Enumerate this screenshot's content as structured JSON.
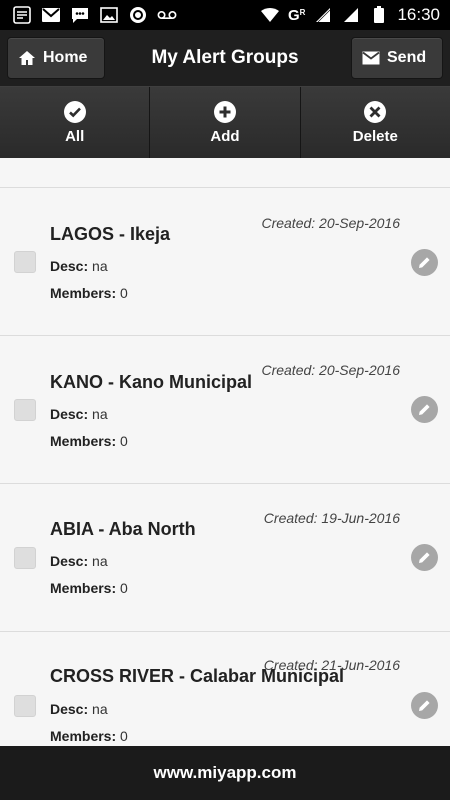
{
  "status_bar": {
    "time": "16:30",
    "network_label": "G",
    "network_sub": "R",
    "icons": [
      "notification-icon",
      "gmail-icon",
      "chat-icon",
      "image-icon",
      "app-icon",
      "voicemail-icon",
      "wifi-icon",
      "signal-icon",
      "signal-icon",
      "battery-icon"
    ]
  },
  "header": {
    "home_label": "Home",
    "title": "My Alert Groups",
    "send_label": "Send"
  },
  "toolbar": {
    "all_label": "All",
    "add_label": "Add",
    "delete_label": "Delete"
  },
  "labels": {
    "desc": "Desc:",
    "members": "Members:"
  },
  "groups": [
    {
      "name": "LAGOS - Ikeja",
      "created": "Created: 20-Sep-2016",
      "desc": "na",
      "members": "0"
    },
    {
      "name": "KANO - Kano Municipal",
      "created": "Created: 20-Sep-2016",
      "desc": "na",
      "members": "0"
    },
    {
      "name": "ABIA - Aba North",
      "created": "Created: 19-Jun-2016",
      "desc": "na",
      "members": "0"
    },
    {
      "name": "CROSS RIVER - Calabar Municipal",
      "created": "Created: 21-Jun-2016",
      "desc": "na",
      "members": "0"
    }
  ],
  "footer": {
    "text": "www.miyapp.com"
  },
  "colors": {
    "header_bg": "#1f1f1f",
    "toolbar_bg": "#2d2d2d",
    "list_bg": "#f4f4f4",
    "footer_bg": "#1b1b1b",
    "edit_icon_bg": "#a7a7a7"
  }
}
